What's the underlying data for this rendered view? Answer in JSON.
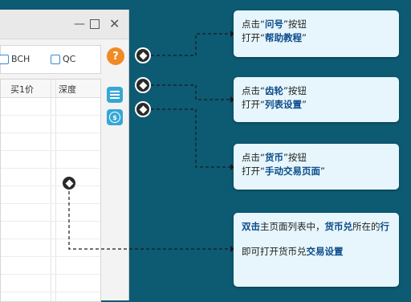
{
  "window": {
    "minimize_glyph": "—",
    "close_glyph": "✕"
  },
  "filters": {
    "bch": "BCH",
    "qc": "QC"
  },
  "help_button": "?",
  "table": {
    "headers": [
      "买1价",
      "深度"
    ]
  },
  "callouts": {
    "help": {
      "line1_prefix": "点击“",
      "line1_bold": "问号",
      "line1_suffix": "”按钮",
      "line2_prefix": "打开“",
      "line2_bold": "帮助教程",
      "line2_suffix": "”"
    },
    "gear": {
      "line1_prefix": "点击“",
      "line1_bold": "齿轮",
      "line1_suffix": "”按钮",
      "line2_prefix": "打开“",
      "line2_bold": "列表设置",
      "line2_suffix": "”"
    },
    "coin": {
      "line1_prefix": "点击“",
      "line1_bold": "货币",
      "line1_suffix": "”按钮",
      "line2_prefix": "打开“",
      "line2_bold": "手动交易页面",
      "line2_suffix": "”"
    },
    "row": {
      "part1_bold": "双击",
      "part2": "主页面列表中，",
      "part3_bold": "货币兑",
      "part4": "所在的",
      "part5_bold": "行",
      "part6": "即可打开货币兑",
      "part7_bold": "交易设置"
    }
  },
  "colors": {
    "background": "#0d5a73",
    "callout_bg": "#e6f6fc",
    "accent_orange": "#f08a24",
    "icon_blue": "#35a7d6"
  }
}
